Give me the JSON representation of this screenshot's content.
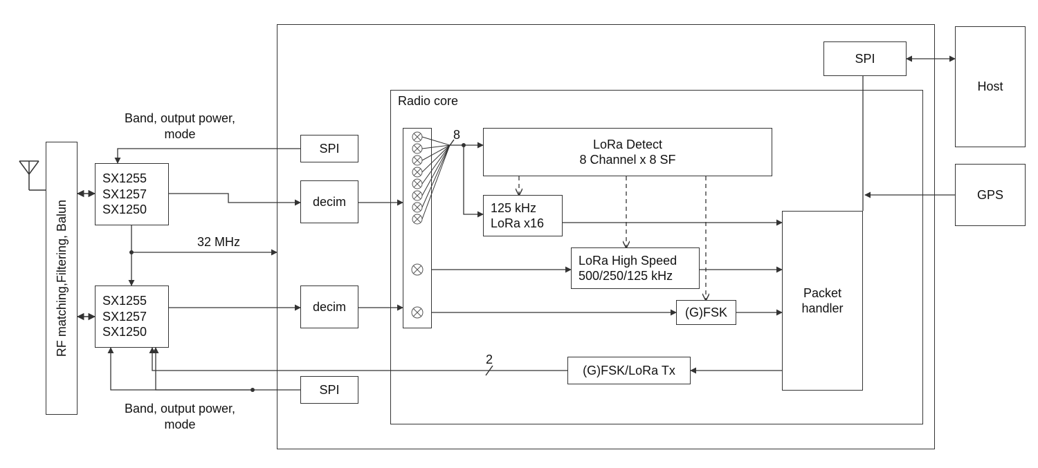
{
  "labels": {
    "rf_balun": "RF matching,Filtering, Balun",
    "sx_a_1": "SX1255",
    "sx_a_2": "SX1257",
    "sx_a_3": "SX1250",
    "sx_b_1": "SX1255",
    "sx_b_2": "SX1257",
    "sx_b_3": "SX1250",
    "band_top_1": "Band, output power,",
    "band_top_2": "mode",
    "band_bot_1": "Band, output power,",
    "band_bot_2": "mode",
    "clk": "32 MHz",
    "spi_top": "SPI",
    "spi_bot": "SPI",
    "decim_a": "decim",
    "decim_b": "decim",
    "radio_core": "Radio core",
    "bus8": "8",
    "bus2": "2",
    "lora_detect_1": "LoRa Detect",
    "lora_detect_2": "8 Channel x 8 SF",
    "sub125_1": "125 kHz",
    "sub125_2": "LoRa x16",
    "lora_hs_1": "LoRa High Speed",
    "lora_hs_2": "500/250/125 kHz",
    "gfsk": "(G)FSK",
    "tx_1": "(G)FSK/LoRa Tx",
    "pkt_1": "Packet",
    "pkt_2": "handler",
    "spi_host": "SPI",
    "host": "Host",
    "gps": "GPS"
  }
}
